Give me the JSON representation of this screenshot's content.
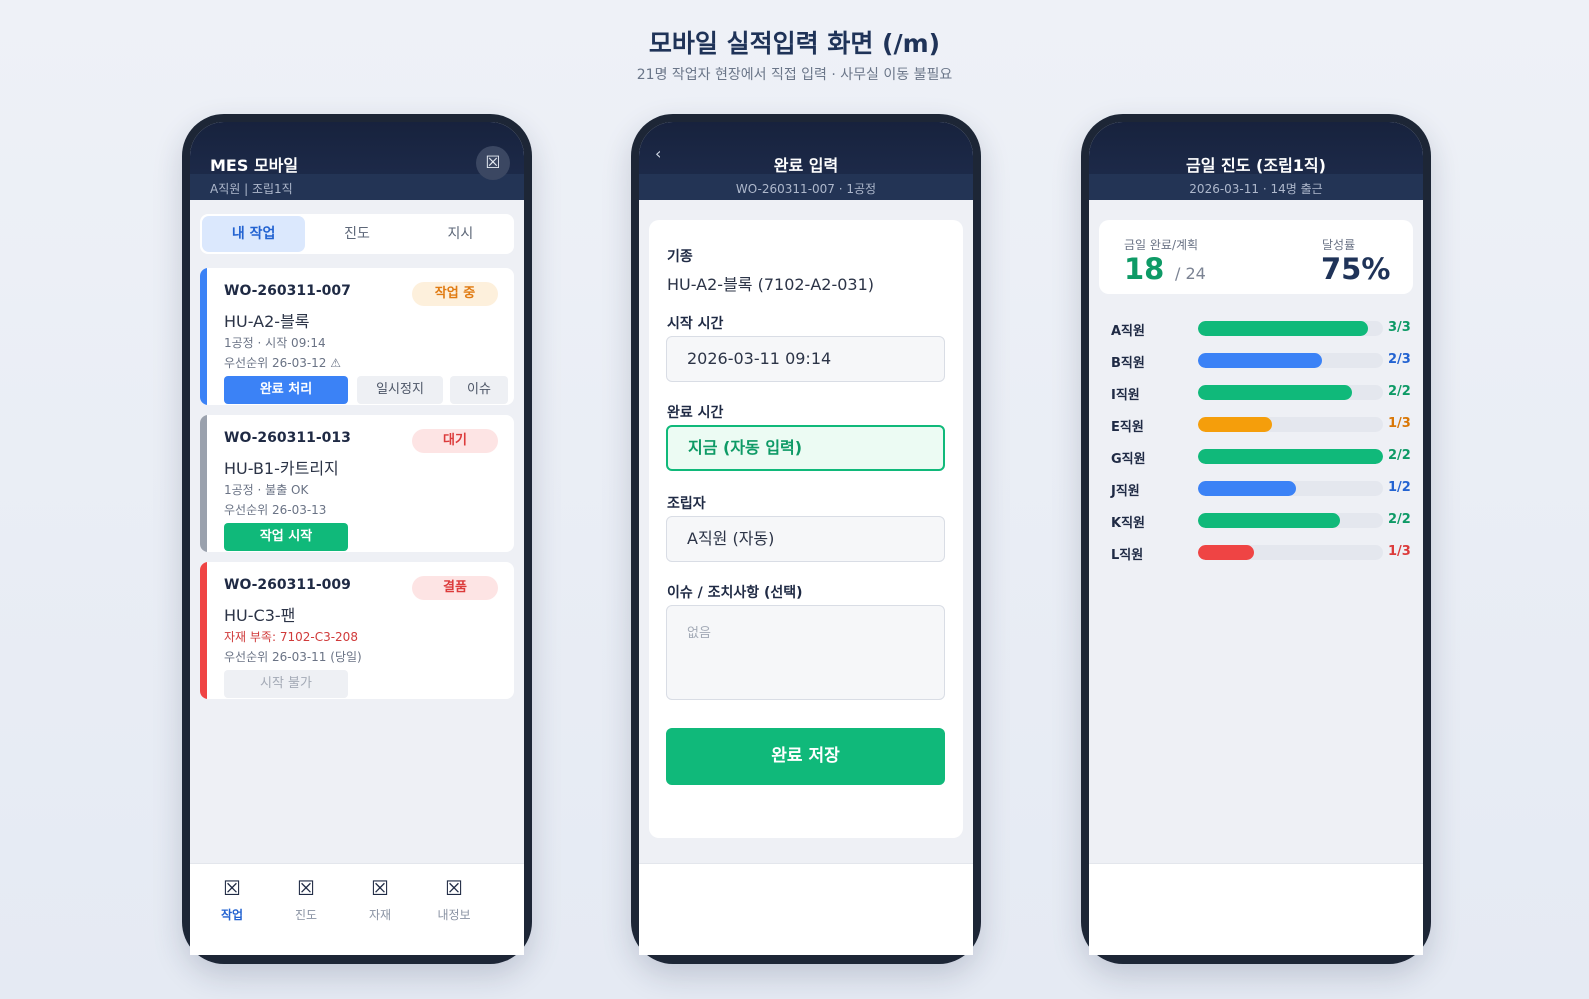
{
  "page": {
    "title": "모바일 실적입력 화면 (/m)",
    "subtitle": "21명 작업자 현장에서 직접 입력 · 사무실 이동 불필요"
  },
  "phone1": {
    "app_title": "MES 모바일",
    "user_line": "A직원 | 조립1직",
    "header_icon": "close-icon",
    "tabs": [
      {
        "label": "내 작업",
        "active": true
      },
      {
        "label": "진도",
        "active": false
      },
      {
        "label": "지시",
        "active": false
      }
    ],
    "cards": [
      {
        "wo": "WO-260311-007",
        "model": "HU-A2-블록",
        "line1": "1공정 · 시작 09:14",
        "line2": "우선순위 26-03-12 ⚠",
        "badge": "작업 중",
        "badge_color": "#e07b12",
        "badge_bg": "#fdf0dc",
        "bar_color": "#3b82f6",
        "buttons": [
          "완료 처리",
          "일시정지",
          "이슈"
        ]
      },
      {
        "wo": "WO-260311-013",
        "model": "HU-B1-카트리지",
        "line1": "1공정 · 불출 OK",
        "line2": "우선순위 26-03-13",
        "badge": "대기",
        "badge_color": "#dc3b3b",
        "badge_bg": "#fde4e4",
        "bar_color": "#9aa1ad",
        "buttons": [
          "작업 시작"
        ]
      },
      {
        "wo": "WO-260311-009",
        "model": "HU-C3-팬",
        "line1": "자재 부족: 7102-C3-208",
        "line2": "우선순위 26-03-11 (당일)",
        "badge": "결품",
        "badge_color": "#dc3b3b",
        "badge_bg": "#fde4e4",
        "bar_color": "#ef4444",
        "line1_color": "#d03a3a",
        "buttons": [
          "시작 불가"
        ]
      }
    ],
    "nav": [
      {
        "label": "작업",
        "icon": "task-icon",
        "active": true
      },
      {
        "label": "진도",
        "icon": "progress-icon",
        "active": false
      },
      {
        "label": "자재",
        "icon": "material-icon",
        "active": false
      },
      {
        "label": "내정보",
        "icon": "profile-icon",
        "active": false
      }
    ]
  },
  "phone2": {
    "back": "‹",
    "title": "완료 입력",
    "sub": "WO-260311-007 · 1공정",
    "model_label": "기종",
    "model_value": "HU-A2-블록 (7102-A2-031)",
    "start_label": "시작 시간",
    "start_value": "2026-03-11 09:14",
    "end_label": "완료 시간",
    "end_value": "지금 (자동 입력)",
    "assembler_label": "조립자",
    "assembler_value": "A직원 (자동)",
    "issue_label": "이슈 / 조치사항 (선택)",
    "issue_placeholder": "없음",
    "save_label": "완료 저장"
  },
  "phone3": {
    "title": "금일 진도 (조립1직)",
    "sub": "2026-03-11 · 14명 출근",
    "done_label": "금일 완료/계획",
    "done": "18",
    "plan": "/ 24",
    "rate_label": "달성률",
    "rate": "75%",
    "workers": [
      {
        "name": "A직원",
        "done": 3,
        "plan": 3,
        "text": "3/3",
        "color": "#10b97a",
        "fill": 0.92
      },
      {
        "name": "B직원",
        "done": 2,
        "plan": 3,
        "text": "2/3",
        "color": "#3b82f6",
        "fill": 0.67
      },
      {
        "name": "I직원",
        "done": 2,
        "plan": 2,
        "text": "2/2",
        "color": "#10b97a",
        "fill": 0.83
      },
      {
        "name": "E직원",
        "done": 1,
        "plan": 3,
        "text": "1/3",
        "color": "#f59e0b",
        "fill": 0.4
      },
      {
        "name": "G직원",
        "done": 2,
        "plan": 2,
        "text": "2/2",
        "color": "#10b97a",
        "fill": 1.0
      },
      {
        "name": "J직원",
        "done": 1,
        "plan": 2,
        "text": "1/2",
        "color": "#3b82f6",
        "fill": 0.53
      },
      {
        "name": "K직원",
        "done": 2,
        "plan": 2,
        "text": "2/2",
        "color": "#10b97a",
        "fill": 0.77
      },
      {
        "name": "L직원",
        "done": 1,
        "plan": 3,
        "text": "1/3",
        "color": "#ef4444",
        "fill": 0.3
      }
    ],
    "value_colors": {
      "green": "#0e9a66",
      "blue": "#2363d1",
      "orange": "#d97706",
      "red": "#dc3b3b"
    }
  }
}
